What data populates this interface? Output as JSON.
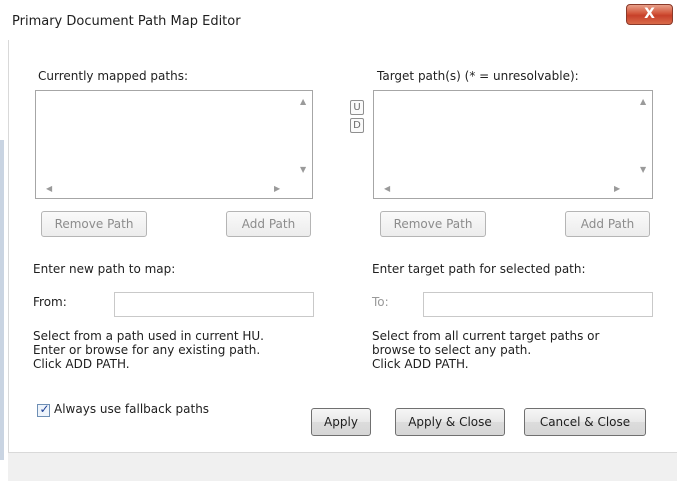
{
  "window": {
    "title": "Primary Document Path Map Editor",
    "close_glyph": "X"
  },
  "left_panel": {
    "list_label": "Currently mapped paths:",
    "remove_button": "Remove Path",
    "add_button": "Add Path",
    "entry_label": "Enter new path to map:",
    "from_label": "From:",
    "from_value": "",
    "help_lines": [
      "Select from a path used in current HU.",
      "Enter or browse for any existing path.",
      "Click ADD PATH."
    ]
  },
  "middle": {
    "up_label": "U",
    "down_label": "D"
  },
  "right_panel": {
    "list_label": "Target path(s) (* = unresolvable):",
    "remove_button": "Remove Path",
    "add_button": "Add Path",
    "entry_label": "Enter target path for selected path:",
    "to_label": "To:",
    "to_value": "",
    "help_lines": [
      "Select from all current target paths or",
      "browse to select any path.",
      "Click ADD PATH."
    ]
  },
  "footer": {
    "fallback_checkbox_label": "Always use fallback paths",
    "fallback_checked": true,
    "apply_button": "Apply",
    "apply_close_button": "Apply & Close",
    "cancel_close_button": "Cancel & Close"
  },
  "icons": {
    "scroll_up": "scroll-up-arrow-icon",
    "scroll_down": "scroll-down-arrow-icon",
    "scroll_left": "scroll-left-arrow-icon",
    "scroll_right": "scroll-right-arrow-icon",
    "check": "checkmark-icon",
    "close": "close-icon"
  },
  "colors": {
    "close_button": "#c7402a",
    "disabled_text": "#8c8c8c",
    "checkmark": "#1c3f94"
  }
}
